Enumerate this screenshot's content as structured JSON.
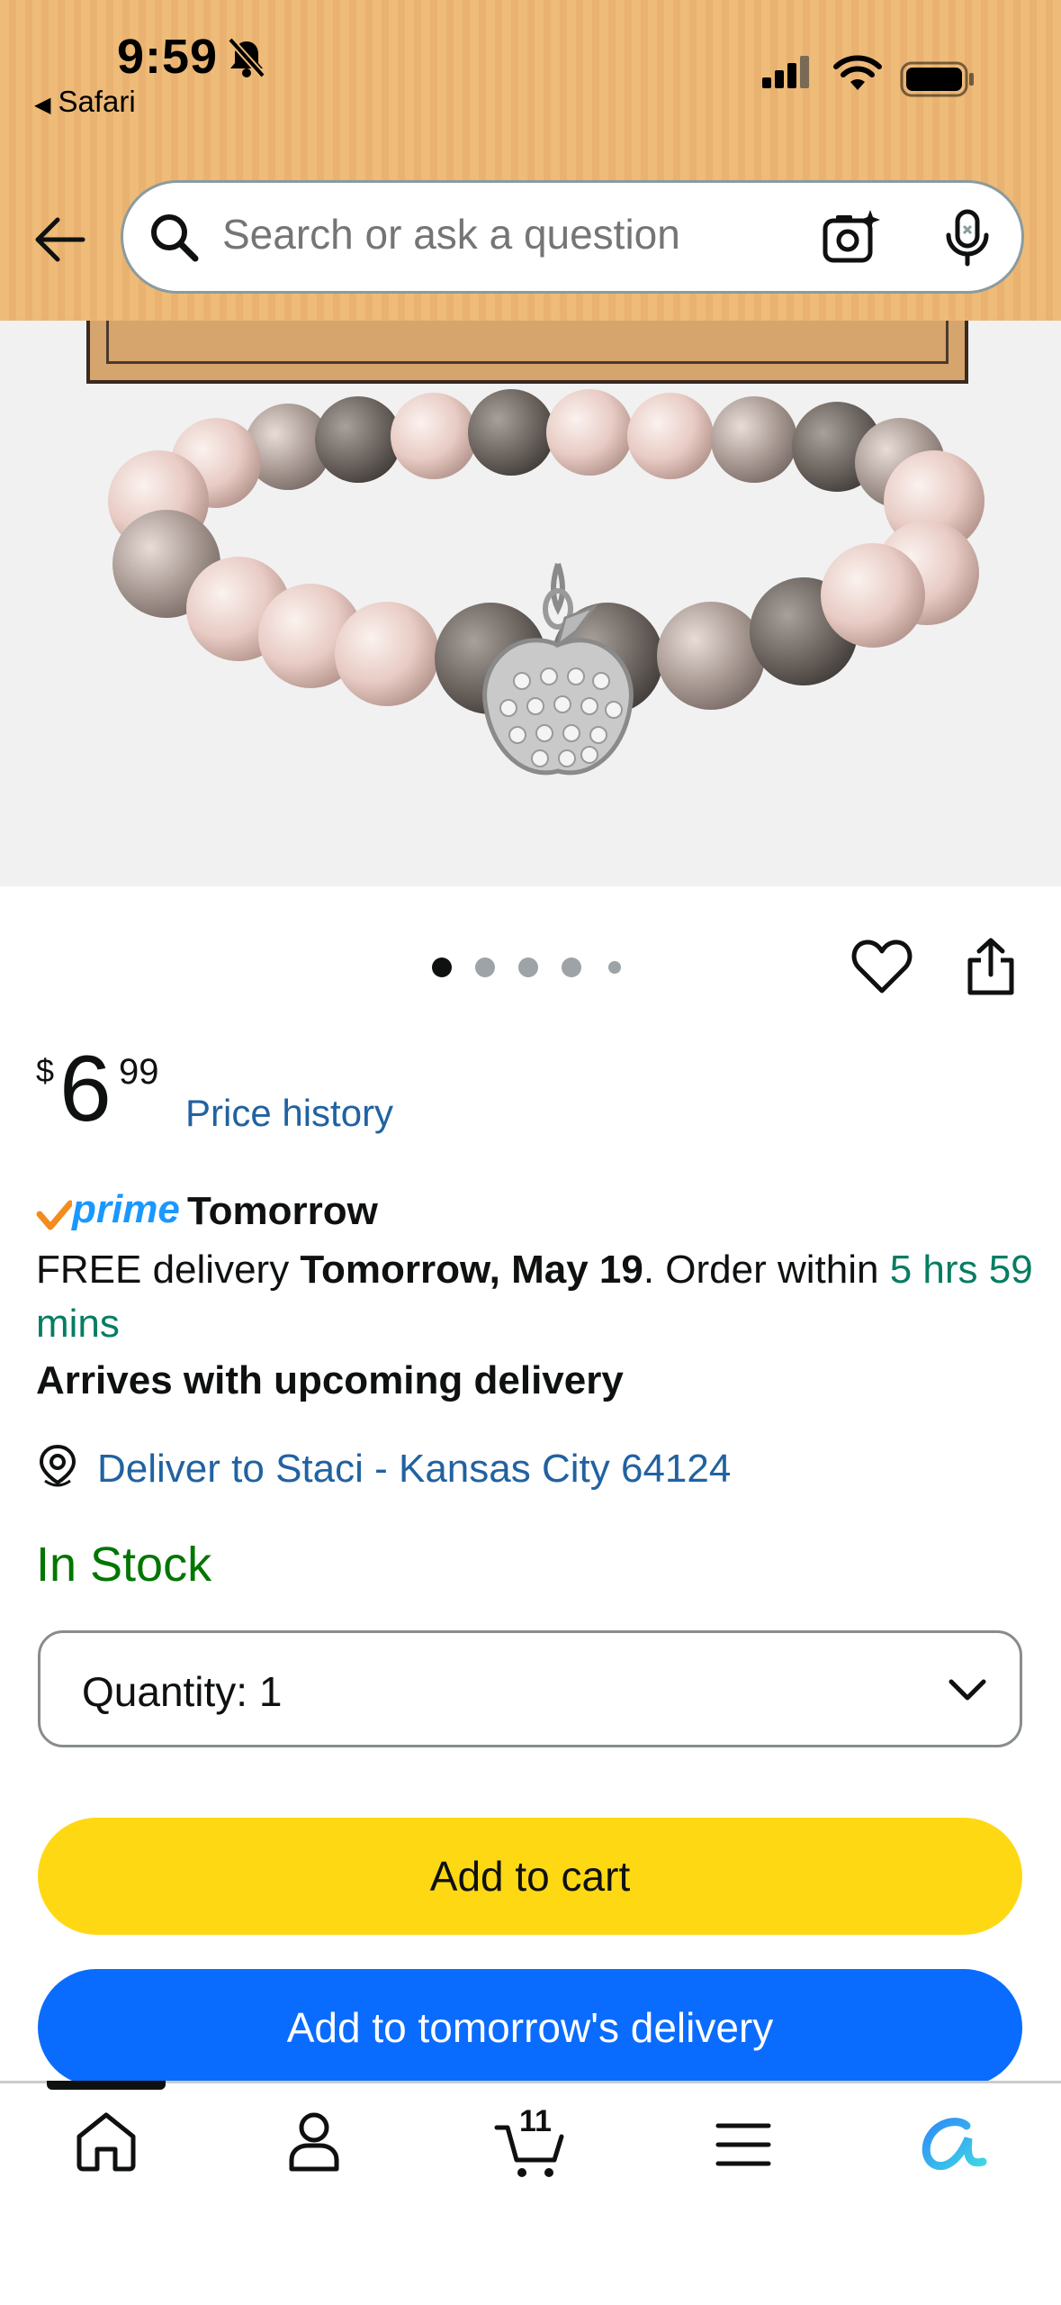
{
  "status_bar": {
    "time": "9:59",
    "back_app": "Safari"
  },
  "search": {
    "placeholder": "Search or ask a question"
  },
  "icons": {
    "back": "arrow-left-icon",
    "search": "search-icon",
    "camera": "camera-sparkle-icon",
    "mic": "microphone-icon",
    "heart": "heart-icon",
    "share": "share-icon",
    "location": "location-pin-icon",
    "chevron": "chevron-down-icon",
    "home": "home-icon",
    "account": "person-icon",
    "cart": "cart-icon",
    "menu": "menu-icon",
    "assistant": "rufus-icon"
  },
  "carousel": {
    "total": 5,
    "active": 1
  },
  "price": {
    "symbol": "$",
    "whole": "6",
    "fraction": "99",
    "history_label": "Price history"
  },
  "delivery": {
    "prime_label": "prime",
    "prime_speed": "Tomorrow",
    "free_prefix": "FREE delivery ",
    "date": "Tomorrow, May 19",
    "order_within": ". Order within ",
    "countdown": "5 hrs 59 mins",
    "arrives": "Arrives with upcoming delivery",
    "deliver_to": "Deliver to Staci - Kansas City 64124"
  },
  "stock": "In Stock",
  "quantity": {
    "label": "Quantity:",
    "value": "1"
  },
  "buttons": {
    "add_to_cart": "Add to cart",
    "add_tomorrow": "Add to tomorrow's delivery"
  },
  "nav": {
    "cart_count": "11"
  },
  "colors": {
    "header": "#eebb78",
    "link": "#2162a1",
    "green": "#067d62",
    "in_stock": "#007600",
    "cart_button": "#ffd814",
    "tomorrow_button": "#0a6cff",
    "prime_blue": "#1a98ff"
  }
}
